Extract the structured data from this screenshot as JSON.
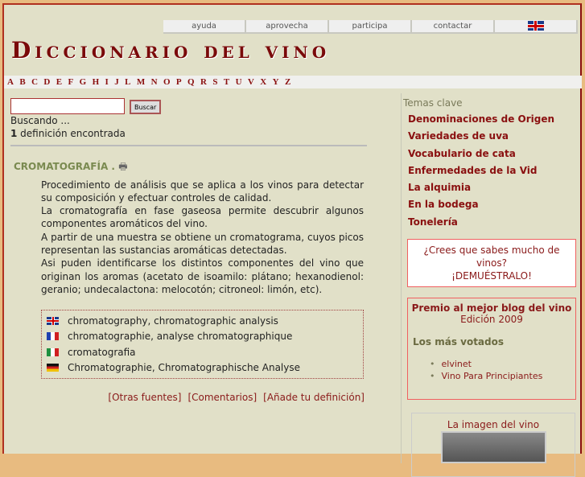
{
  "nav": [
    "ayuda",
    "aprovecha",
    "participa",
    "contactar"
  ],
  "logo": "Diccionario del vino",
  "alphabet": [
    "A",
    "B",
    "C",
    "D",
    "E",
    "F",
    "G",
    "H",
    "I",
    "J",
    "L",
    "M",
    "N",
    "O",
    "P",
    "Q",
    "R",
    "S",
    "T",
    "U",
    "V",
    "X",
    "Y",
    "Z"
  ],
  "search": {
    "value": "",
    "button": "Buscar",
    "status": "Buscando ...",
    "count": "1",
    "count_label": " definición encontrada"
  },
  "entry": {
    "term": "CROMATOGRAFÍA .",
    "paragraphs": [
      "Procedimiento de análisis que se aplica a los vinos para detectar su composición y efectuar controles de calidad.",
      "La cromatografía en fase gaseosa permite descubrir algunos componentes aromáticos del vino.",
      "A partir de una muestra se obtiene un cromatograma, cuyos picos representan las sustancias aromáticas detectadas.",
      "Asi puden identificarse los distintos componentes del vino que originan los aromas (acetato de isoamilo: plátano; hexanodienol: geranio; undecalactona: melocotón; citroneol: limón, etc)."
    ],
    "translations": [
      {
        "lang": "en",
        "text": "chromatography, chromatographic analysis"
      },
      {
        "lang": "fr",
        "text": "chromatographie, analyse chromatographique"
      },
      {
        "lang": "it",
        "text": "cromatografia"
      },
      {
        "lang": "de",
        "text": "Chromatographie, Chromatographische Analyse"
      }
    ],
    "links": [
      "[Otras fuentes]",
      "[Comentarios]",
      "[Añade tu definición]"
    ]
  },
  "sidebar": {
    "heading": "Temas clave",
    "topics": [
      "Denominaciones de Origen",
      "Variedades de uva",
      "Vocabulario de cata",
      "Enfermedades de la Vid",
      "La alquimia",
      "En la bodega",
      "Tonelería"
    ],
    "quiz": [
      "¿Crees que sabes mucho de vinos?",
      "¡DEMUÉSTRALO!"
    ],
    "premio": {
      "title": "Premio al mejor blog del vino",
      "edition": "Edición 2009",
      "voted": "Los más votados",
      "items": [
        "elvinet",
        "Vino Para Principiantes"
      ]
    },
    "image_title": "La imagen del vino"
  }
}
